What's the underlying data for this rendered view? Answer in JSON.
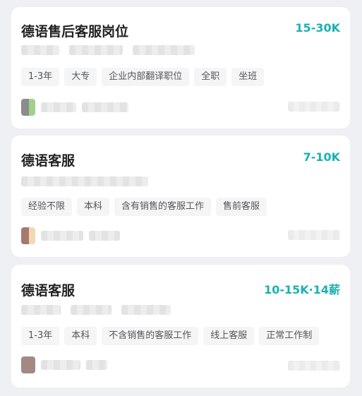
{
  "jobs": [
    {
      "title": "德语售后客服岗位",
      "salary": "15-30K",
      "tags": [
        "1-3年",
        "大专",
        "企业内部翻译职位",
        "全职",
        "坐班"
      ]
    },
    {
      "title": "德语客服",
      "salary": "7-10K",
      "tags": [
        "经验不限",
        "本科",
        "含有销售的客服工作",
        "售前客服"
      ]
    },
    {
      "title": "德语客服",
      "salary": "10-15K·14薪",
      "tags": [
        "1-3年",
        "本科",
        "不含销售的客服工作",
        "线上客服",
        "正常工作制"
      ]
    }
  ],
  "colors": {
    "salary": "#1ab1b2",
    "title": "#222222",
    "tag_bg": "#f4f5f7",
    "page_bg": "#eef0f3"
  }
}
